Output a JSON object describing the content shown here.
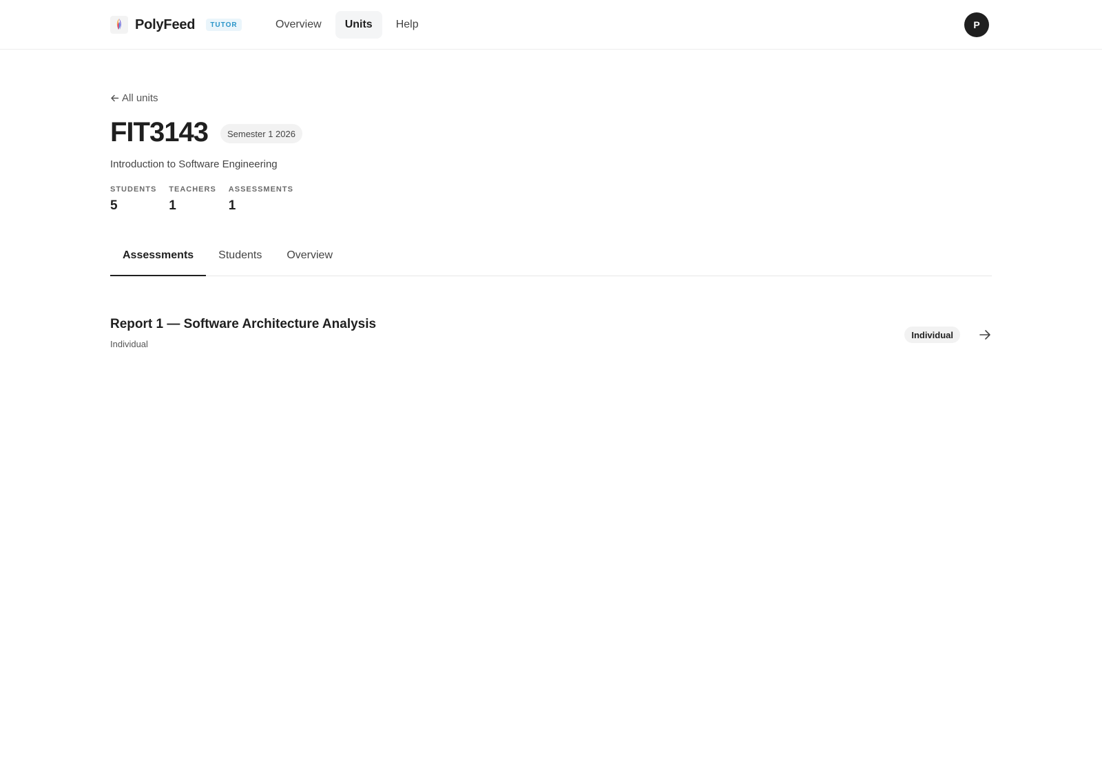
{
  "app": {
    "name": "PolyFeed",
    "role_badge": "TUTOR",
    "logo_icon": "polyfeed-logo-icon"
  },
  "nav": {
    "items": [
      {
        "label": "Overview",
        "active": false
      },
      {
        "label": "Units",
        "active": true
      },
      {
        "label": "Help",
        "active": false
      }
    ]
  },
  "user": {
    "avatar_initial": "P"
  },
  "page": {
    "back_label": "All units",
    "unit_code": "FIT3143",
    "semester": "Semester 1 2026",
    "unit_name": "Introduction to Software Engineering",
    "stats": [
      {
        "label": "STUDENTS",
        "value": "5"
      },
      {
        "label": "TEACHERS",
        "value": "1"
      },
      {
        "label": "ASSESSMENTS",
        "value": "1"
      }
    ]
  },
  "tabs": [
    {
      "label": "Assessments",
      "active": true
    },
    {
      "label": "Students",
      "active": false
    },
    {
      "label": "Overview",
      "active": false
    }
  ],
  "assessments": [
    {
      "title": "Report 1 — Software Architecture Analysis",
      "subtitle": "Individual",
      "badge": "Individual",
      "action_icon": "arrow-right-icon"
    }
  ],
  "colors": {
    "text_primary": "#1f1f1f",
    "badge_accent": "#2a95c9",
    "badge_accent_bg": "#eaf5fb",
    "avatar_bg": "#1f1f1f"
  }
}
